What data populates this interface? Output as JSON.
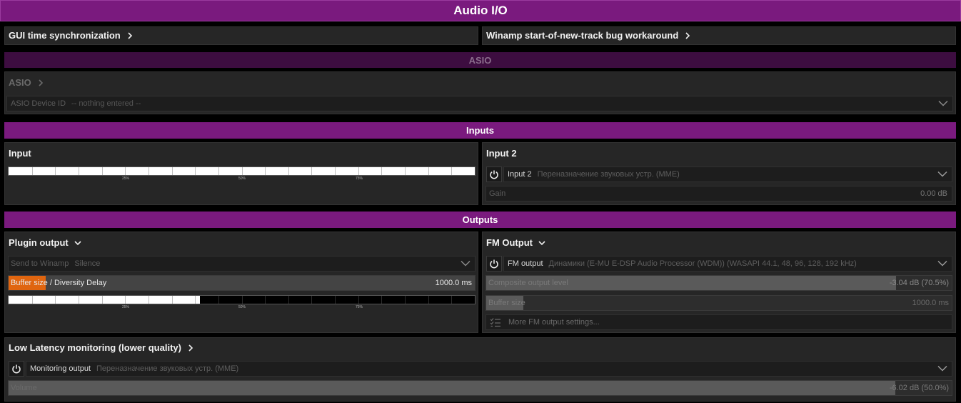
{
  "window": {
    "title": "Audio I/O"
  },
  "top_links": {
    "gui_sync": "GUI time synchronization",
    "winamp_bug": "Winamp start-of-new-track bug workaround"
  },
  "asio": {
    "section": "ASIO",
    "heading": "ASIO",
    "device_label": "ASIO Device ID",
    "device_value": "-- nothing entered --"
  },
  "inputs": {
    "section": "Inputs",
    "input1": {
      "title": "Input",
      "scale": [
        "25%",
        "50%",
        "75%"
      ],
      "level_pct": 100
    },
    "input2": {
      "title": "Input 2",
      "device_name": "Input 2",
      "device_sub": "Переназначение звуковых устр. (MME)",
      "gain_label": "Gain",
      "gain_value": "0.00 dB"
    }
  },
  "outputs": {
    "section": "Outputs",
    "plugin": {
      "title": "Plugin output",
      "send_label": "Send to Winamp",
      "send_value": "Silence",
      "buffer_label_a": "Buffer size",
      "buffer_label_b": " / Diversity Delay",
      "buffer_value": "1000.0 ms",
      "buffer_fill_pct": 8,
      "scale": [
        "25%",
        "50%",
        "75%"
      ],
      "level_pct": 41
    },
    "fm": {
      "title": "FM Output",
      "device_name": "FM output",
      "device_sub": "Динамики (E-MU E-DSP Audio Processor (WDM)) (WASAPI 44.1, 48, 96, 128, 192 kHz)",
      "composite_label": "Composite output level",
      "composite_value": "-3.04 dB (70.5%)",
      "composite_fill_pct": 88,
      "buffer_label": "Buffer size",
      "buffer_value": "1000.0 ms",
      "buffer_fill_pct": 8,
      "more_label": "More FM output settings..."
    }
  },
  "monitoring": {
    "title": "Low Latency monitoring (lower quality)",
    "device_name": "Monitoring output",
    "device_sub": "Переназначение звуковых устр. (MME)",
    "volume_label": "Volume",
    "volume_value": "-6.02 dB (50.0%)",
    "volume_fill_pct": 94
  },
  "colors": {
    "accent": "#7a1a7e",
    "accent_dim": "#3d0d40",
    "buffer_fill": "#e0650f",
    "slider_fill": "#5a5a5a"
  }
}
